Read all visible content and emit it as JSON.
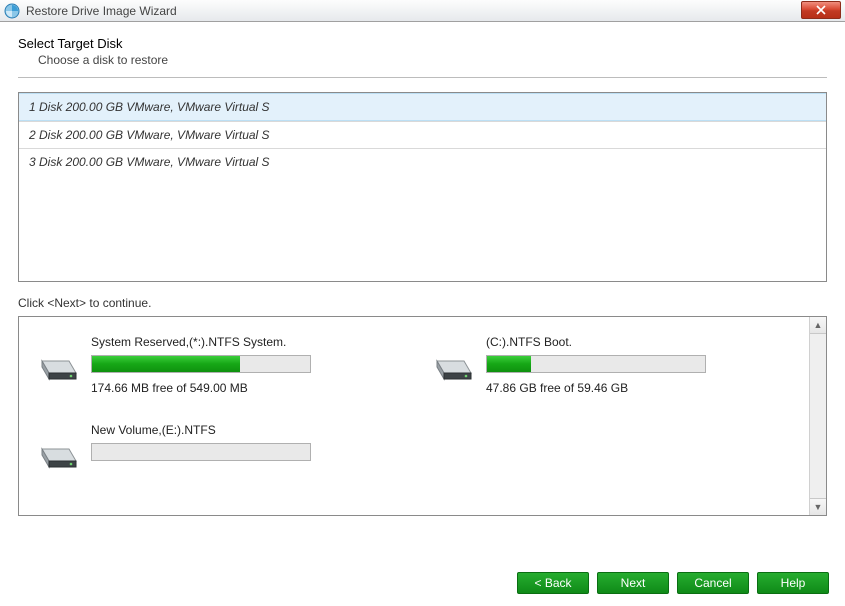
{
  "window": {
    "title": "Restore Drive Image Wizard"
  },
  "page": {
    "heading": "Select Target Disk",
    "subheading": "Choose a disk to restore",
    "continue_label": "Click <Next> to continue."
  },
  "disks": [
    {
      "label": "1 Disk 200.00 GB VMware,  VMware Virtual S",
      "selected": true
    },
    {
      "label": "2 Disk 200.00 GB VMware,  VMware Virtual S",
      "selected": false
    },
    {
      "label": "3 Disk 200.00 GB VMware,  VMware Virtual S",
      "selected": false
    }
  ],
  "partitions": [
    {
      "label": "System Reserved,(*:).NTFS System.",
      "free": "174.66 MB free of 549.00 MB",
      "used_pct": 68
    },
    {
      "label": "(C:).NTFS Boot.",
      "free": "47.86 GB free of 59.46 GB",
      "used_pct": 20
    },
    {
      "label": "New Volume,(E:).NTFS",
      "free": "",
      "used_pct": 0
    }
  ],
  "buttons": {
    "back": "< Back",
    "next": "Next",
    "cancel": "Cancel",
    "help": "Help"
  }
}
